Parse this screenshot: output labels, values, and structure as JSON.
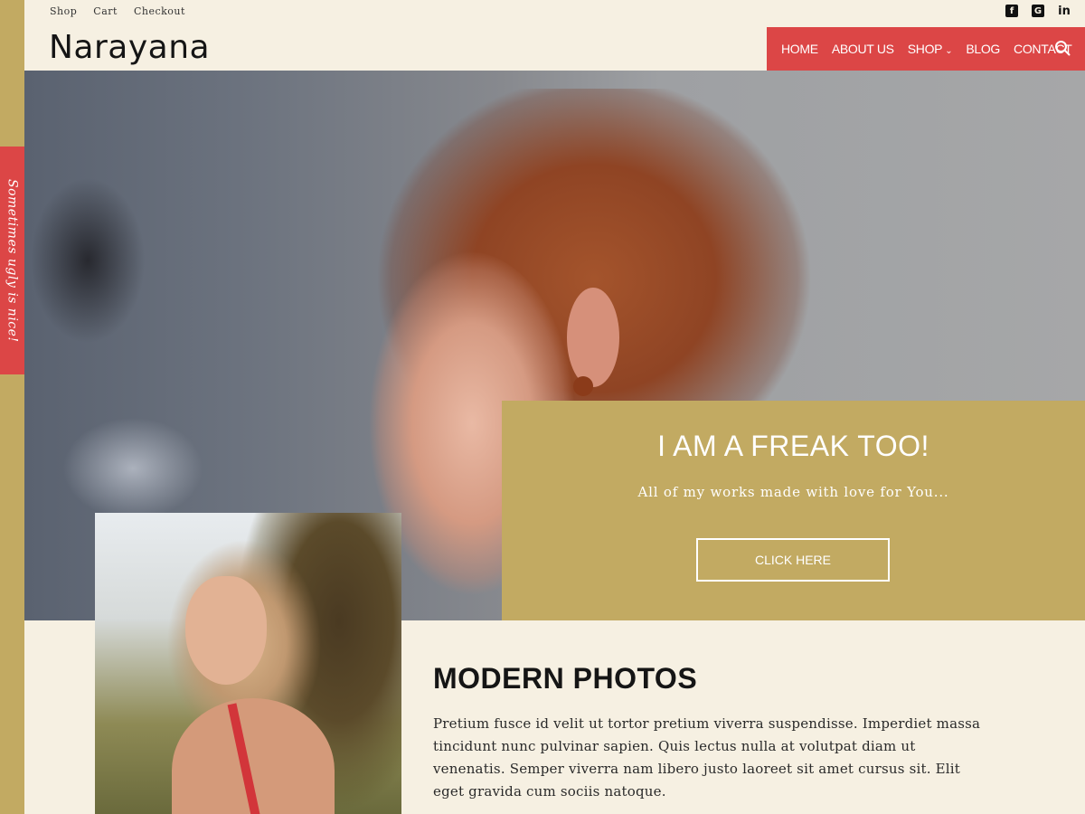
{
  "site": {
    "brand": "Narayana"
  },
  "sidebar": {
    "tagline": "Sometimes ugly is nice!"
  },
  "top_links": [
    "Shop",
    "Cart",
    "Checkout"
  ],
  "social": [
    "facebook-icon",
    "google-plus-icon",
    "linkedin-icon"
  ],
  "nav": {
    "items": [
      {
        "label": "HOME"
      },
      {
        "label": "ABOUT US"
      },
      {
        "label": "SHOP",
        "has_dropdown": true
      },
      {
        "label": "BLOG"
      },
      {
        "label": "CONTACT"
      }
    ]
  },
  "hero": {
    "title": "I AM A FREAK TOO!",
    "subtitle": "All of my works made with love for You...",
    "button": "CLICK HERE"
  },
  "section": {
    "title": "MODERN PHOTOS",
    "text": "Pretium fusce id velit ut tortor pretium viverra suspendisse. Imperdiet massa tincidunt nunc pulvinar sapien. Quis lectus nulla at volutpat diam ut venenatis. Semper viverra nam libero justo laoreet sit amet cursus sit. Elit eget gravida cum sociis natoque."
  },
  "colors": {
    "accent_red": "#dc4646",
    "accent_gold": "#c2aa62",
    "background": "#f6f0e2"
  }
}
